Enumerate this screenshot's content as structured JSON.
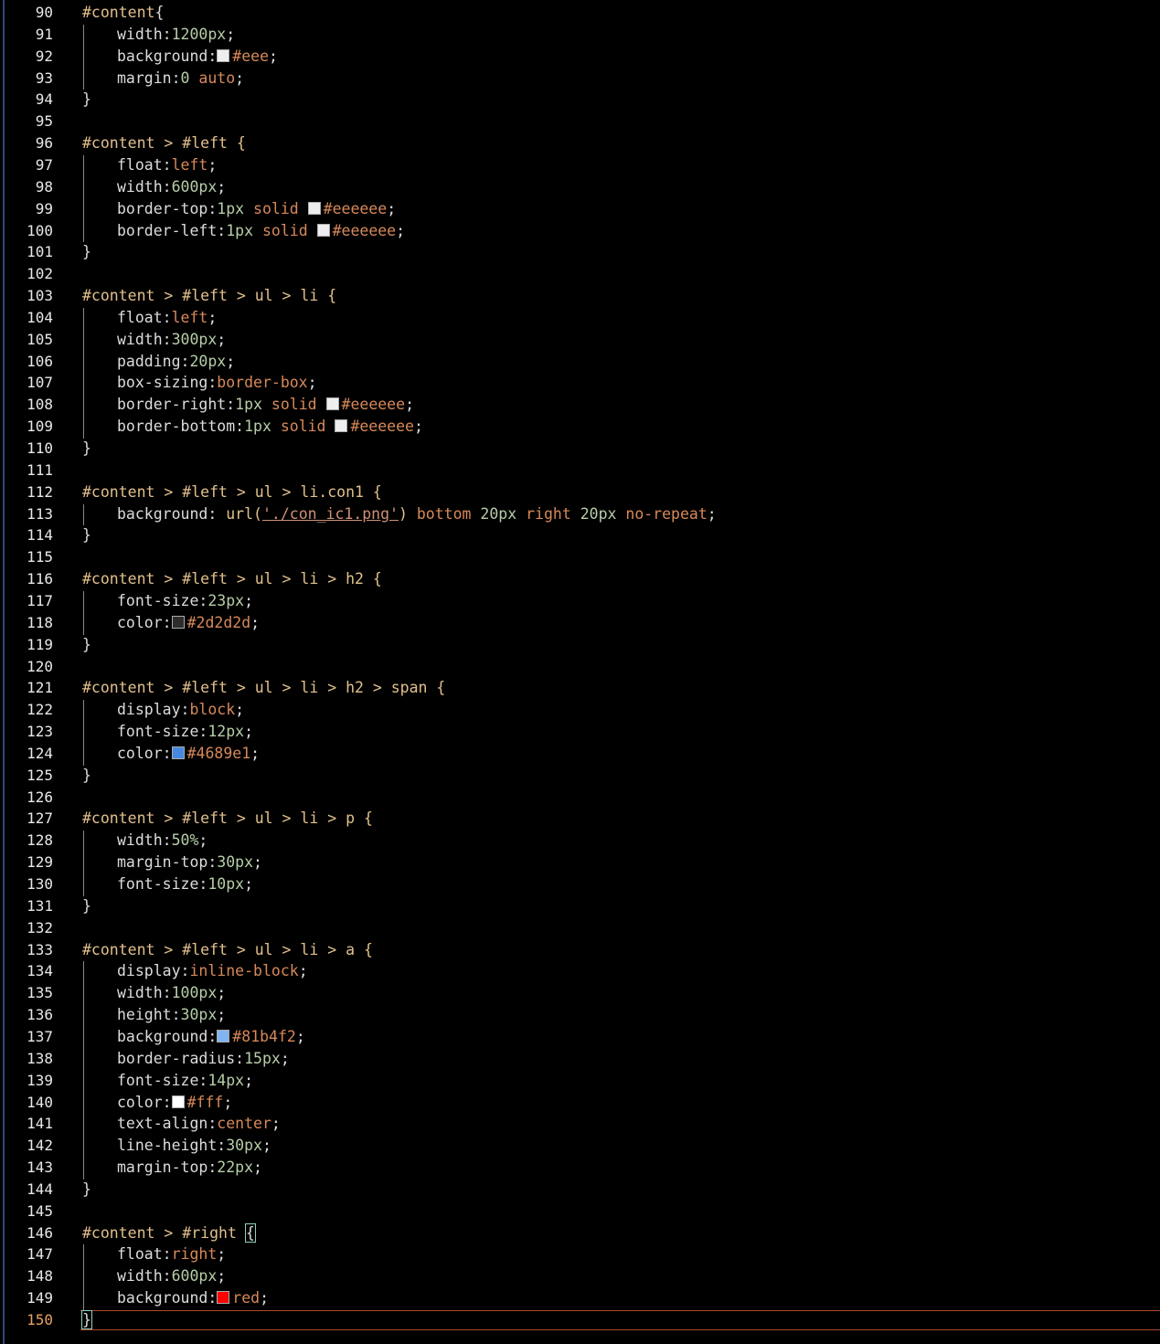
{
  "editor": {
    "active_line": 150,
    "lines": [
      {
        "n": 90,
        "indent": 0,
        "tokens": [
          {
            "t": "#content",
            "c": "sel"
          },
          {
            "t": "{",
            "c": "punc"
          }
        ]
      },
      {
        "n": 91,
        "indent": 1,
        "tokens": [
          {
            "t": "width",
            "c": "prop"
          },
          {
            "t": ":",
            "c": "punc"
          },
          {
            "t": "1200px",
            "c": "val"
          },
          {
            "t": ";",
            "c": "punc"
          }
        ]
      },
      {
        "n": 92,
        "indent": 1,
        "tokens": [
          {
            "t": "background",
            "c": "prop"
          },
          {
            "t": ":",
            "c": "punc"
          },
          {
            "sw": "#eeeeee"
          },
          {
            "t": "#eee",
            "c": "kw"
          },
          {
            "t": ";",
            "c": "punc"
          }
        ]
      },
      {
        "n": 93,
        "indent": 1,
        "tokens": [
          {
            "t": "margin",
            "c": "prop"
          },
          {
            "t": ":",
            "c": "punc"
          },
          {
            "t": "0",
            "c": "val"
          },
          {
            "t": " auto",
            "c": "kw"
          },
          {
            "t": ";",
            "c": "punc"
          }
        ]
      },
      {
        "n": 94,
        "indent": 0,
        "tokens": [
          {
            "t": "}",
            "c": "punc"
          }
        ]
      },
      {
        "n": 95,
        "indent": 0,
        "tokens": []
      },
      {
        "n": 96,
        "indent": 0,
        "tokens": [
          {
            "t": "#content > #left {",
            "c": "sel"
          }
        ]
      },
      {
        "n": 97,
        "indent": 1,
        "tokens": [
          {
            "t": "float",
            "c": "prop"
          },
          {
            "t": ":",
            "c": "punc"
          },
          {
            "t": "left",
            "c": "kw"
          },
          {
            "t": ";",
            "c": "punc"
          }
        ]
      },
      {
        "n": 98,
        "indent": 1,
        "tokens": [
          {
            "t": "width",
            "c": "prop"
          },
          {
            "t": ":",
            "c": "punc"
          },
          {
            "t": "600px",
            "c": "val"
          },
          {
            "t": ";",
            "c": "punc"
          }
        ]
      },
      {
        "n": 99,
        "indent": 1,
        "tokens": [
          {
            "t": "border-top",
            "c": "prop"
          },
          {
            "t": ":",
            "c": "punc"
          },
          {
            "t": "1px",
            "c": "val"
          },
          {
            "t": " solid ",
            "c": "kw"
          },
          {
            "sw": "#eeeeee"
          },
          {
            "t": "#eeeeee",
            "c": "kw"
          },
          {
            "t": ";",
            "c": "punc"
          }
        ]
      },
      {
        "n": 100,
        "indent": 1,
        "tokens": [
          {
            "t": "border-left",
            "c": "prop"
          },
          {
            "t": ":",
            "c": "punc"
          },
          {
            "t": "1px",
            "c": "val"
          },
          {
            "t": " solid ",
            "c": "kw"
          },
          {
            "sw": "#eeeeee"
          },
          {
            "t": "#eeeeee",
            "c": "kw"
          },
          {
            "t": ";",
            "c": "punc"
          }
        ]
      },
      {
        "n": 101,
        "indent": 0,
        "tokens": [
          {
            "t": "}",
            "c": "punc"
          }
        ]
      },
      {
        "n": 102,
        "indent": 0,
        "tokens": []
      },
      {
        "n": 103,
        "indent": 0,
        "tokens": [
          {
            "t": "#content > #left > ul > li {",
            "c": "sel"
          }
        ]
      },
      {
        "n": 104,
        "indent": 1,
        "tokens": [
          {
            "t": "float",
            "c": "prop"
          },
          {
            "t": ":",
            "c": "punc"
          },
          {
            "t": "left",
            "c": "kw"
          },
          {
            "t": ";",
            "c": "punc"
          }
        ]
      },
      {
        "n": 105,
        "indent": 1,
        "tokens": [
          {
            "t": "width",
            "c": "prop"
          },
          {
            "t": ":",
            "c": "punc"
          },
          {
            "t": "300px",
            "c": "val"
          },
          {
            "t": ";",
            "c": "punc"
          }
        ]
      },
      {
        "n": 106,
        "indent": 1,
        "tokens": [
          {
            "t": "padding",
            "c": "prop"
          },
          {
            "t": ":",
            "c": "punc"
          },
          {
            "t": "20px",
            "c": "val"
          },
          {
            "t": ";",
            "c": "punc"
          }
        ]
      },
      {
        "n": 107,
        "indent": 1,
        "tokens": [
          {
            "t": "box-sizing",
            "c": "prop"
          },
          {
            "t": ":",
            "c": "punc"
          },
          {
            "t": "border-box",
            "c": "kw"
          },
          {
            "t": ";",
            "c": "punc"
          }
        ]
      },
      {
        "n": 108,
        "indent": 1,
        "tokens": [
          {
            "t": "border-right",
            "c": "prop"
          },
          {
            "t": ":",
            "c": "punc"
          },
          {
            "t": "1px",
            "c": "val"
          },
          {
            "t": " solid ",
            "c": "kw"
          },
          {
            "sw": "#eeeeee"
          },
          {
            "t": "#eeeeee",
            "c": "kw"
          },
          {
            "t": ";",
            "c": "punc"
          }
        ]
      },
      {
        "n": 109,
        "indent": 1,
        "tokens": [
          {
            "t": "border-bottom",
            "c": "prop"
          },
          {
            "t": ":",
            "c": "punc"
          },
          {
            "t": "1px",
            "c": "val"
          },
          {
            "t": " solid ",
            "c": "kw"
          },
          {
            "sw": "#eeeeee"
          },
          {
            "t": "#eeeeee",
            "c": "kw"
          },
          {
            "t": ";",
            "c": "punc"
          }
        ]
      },
      {
        "n": 110,
        "indent": 0,
        "tokens": [
          {
            "t": "}",
            "c": "punc"
          }
        ]
      },
      {
        "n": 111,
        "indent": 0,
        "tokens": []
      },
      {
        "n": 112,
        "indent": 0,
        "tokens": [
          {
            "t": "#content > #left > ul > li.con1 {",
            "c": "sel"
          }
        ]
      },
      {
        "n": 113,
        "indent": 1,
        "tokens": [
          {
            "t": "background",
            "c": "prop"
          },
          {
            "t": ": ",
            "c": "punc"
          },
          {
            "t": "url(",
            "c": "sel"
          },
          {
            "t": "'./con_ic1.png'",
            "c": "str"
          },
          {
            "t": ")",
            "c": "sel"
          },
          {
            "t": " bottom ",
            "c": "kw"
          },
          {
            "t": "20px",
            "c": "val"
          },
          {
            "t": " right ",
            "c": "kw"
          },
          {
            "t": "20px",
            "c": "val"
          },
          {
            "t": " no-repeat",
            "c": "kw"
          },
          {
            "t": ";",
            "c": "punc"
          }
        ]
      },
      {
        "n": 114,
        "indent": 0,
        "tokens": [
          {
            "t": "}",
            "c": "punc"
          }
        ]
      },
      {
        "n": 115,
        "indent": 0,
        "tokens": []
      },
      {
        "n": 116,
        "indent": 0,
        "tokens": [
          {
            "t": "#content > #left > ul > li > h2 {",
            "c": "sel"
          }
        ]
      },
      {
        "n": 117,
        "indent": 1,
        "tokens": [
          {
            "t": "font-size",
            "c": "prop"
          },
          {
            "t": ":",
            "c": "punc"
          },
          {
            "t": "23px",
            "c": "val"
          },
          {
            "t": ";",
            "c": "punc"
          }
        ]
      },
      {
        "n": 118,
        "indent": 1,
        "tokens": [
          {
            "t": "color",
            "c": "prop"
          },
          {
            "t": ":",
            "c": "punc"
          },
          {
            "sw": "#2d2d2d"
          },
          {
            "t": "#2d2d2d",
            "c": "kw"
          },
          {
            "t": ";",
            "c": "punc"
          }
        ]
      },
      {
        "n": 119,
        "indent": 0,
        "tokens": [
          {
            "t": "}",
            "c": "punc"
          }
        ]
      },
      {
        "n": 120,
        "indent": 0,
        "tokens": []
      },
      {
        "n": 121,
        "indent": 0,
        "tokens": [
          {
            "t": "#content > #left > ul > li > h2 > span {",
            "c": "sel"
          }
        ]
      },
      {
        "n": 122,
        "indent": 1,
        "tokens": [
          {
            "t": "display",
            "c": "prop"
          },
          {
            "t": ":",
            "c": "punc"
          },
          {
            "t": "block",
            "c": "kw"
          },
          {
            "t": ";",
            "c": "punc"
          }
        ]
      },
      {
        "n": 123,
        "indent": 1,
        "tokens": [
          {
            "t": "font-size",
            "c": "prop"
          },
          {
            "t": ":",
            "c": "punc"
          },
          {
            "t": "12px",
            "c": "val"
          },
          {
            "t": ";",
            "c": "punc"
          }
        ]
      },
      {
        "n": 124,
        "indent": 1,
        "tokens": [
          {
            "t": "color",
            "c": "prop"
          },
          {
            "t": ":",
            "c": "punc"
          },
          {
            "sw": "#4689e1"
          },
          {
            "t": "#4689e1",
            "c": "kw"
          },
          {
            "t": ";",
            "c": "punc"
          }
        ]
      },
      {
        "n": 125,
        "indent": 0,
        "tokens": [
          {
            "t": "}",
            "c": "punc"
          }
        ]
      },
      {
        "n": 126,
        "indent": 0,
        "tokens": []
      },
      {
        "n": 127,
        "indent": 0,
        "tokens": [
          {
            "t": "#content > #left > ul > li > p {",
            "c": "sel"
          }
        ]
      },
      {
        "n": 128,
        "indent": 1,
        "tokens": [
          {
            "t": "width",
            "c": "prop"
          },
          {
            "t": ":",
            "c": "punc"
          },
          {
            "t": "50%",
            "c": "val"
          },
          {
            "t": ";",
            "c": "punc"
          }
        ]
      },
      {
        "n": 129,
        "indent": 1,
        "tokens": [
          {
            "t": "margin-top",
            "c": "prop"
          },
          {
            "t": ":",
            "c": "punc"
          },
          {
            "t": "30px",
            "c": "val"
          },
          {
            "t": ";",
            "c": "punc"
          }
        ]
      },
      {
        "n": 130,
        "indent": 1,
        "tokens": [
          {
            "t": "font-size",
            "c": "prop"
          },
          {
            "t": ":",
            "c": "punc"
          },
          {
            "t": "10px",
            "c": "val"
          },
          {
            "t": ";",
            "c": "punc"
          }
        ]
      },
      {
        "n": 131,
        "indent": 0,
        "tokens": [
          {
            "t": "}",
            "c": "punc"
          }
        ]
      },
      {
        "n": 132,
        "indent": 0,
        "tokens": []
      },
      {
        "n": 133,
        "indent": 0,
        "tokens": [
          {
            "t": "#content > #left > ul > li > a {",
            "c": "sel"
          }
        ]
      },
      {
        "n": 134,
        "indent": 1,
        "tokens": [
          {
            "t": "display",
            "c": "prop"
          },
          {
            "t": ":",
            "c": "punc"
          },
          {
            "t": "inline-block",
            "c": "kw"
          },
          {
            "t": ";",
            "c": "punc"
          }
        ]
      },
      {
        "n": 135,
        "indent": 1,
        "tokens": [
          {
            "t": "width",
            "c": "prop"
          },
          {
            "t": ":",
            "c": "punc"
          },
          {
            "t": "100px",
            "c": "val"
          },
          {
            "t": ";",
            "c": "punc"
          }
        ]
      },
      {
        "n": 136,
        "indent": 1,
        "tokens": [
          {
            "t": "height",
            "c": "prop"
          },
          {
            "t": ":",
            "c": "punc"
          },
          {
            "t": "30px",
            "c": "val"
          },
          {
            "t": ";",
            "c": "punc"
          }
        ]
      },
      {
        "n": 137,
        "indent": 1,
        "tokens": [
          {
            "t": "background",
            "c": "prop"
          },
          {
            "t": ":",
            "c": "punc"
          },
          {
            "sw": "#81b4f2"
          },
          {
            "t": "#81b4f2",
            "c": "kw"
          },
          {
            "t": ";",
            "c": "punc"
          }
        ]
      },
      {
        "n": 138,
        "indent": 1,
        "tokens": [
          {
            "t": "border-radius",
            "c": "prop"
          },
          {
            "t": ":",
            "c": "punc"
          },
          {
            "t": "15px",
            "c": "val"
          },
          {
            "t": ";",
            "c": "punc"
          }
        ]
      },
      {
        "n": 139,
        "indent": 1,
        "tokens": [
          {
            "t": "font-size",
            "c": "prop"
          },
          {
            "t": ":",
            "c": "punc"
          },
          {
            "t": "14px",
            "c": "val"
          },
          {
            "t": ";",
            "c": "punc"
          }
        ]
      },
      {
        "n": 140,
        "indent": 1,
        "tokens": [
          {
            "t": "color",
            "c": "prop"
          },
          {
            "t": ":",
            "c": "punc"
          },
          {
            "sw": "#ffffff"
          },
          {
            "t": "#fff",
            "c": "kw"
          },
          {
            "t": ";",
            "c": "punc"
          }
        ]
      },
      {
        "n": 141,
        "indent": 1,
        "tokens": [
          {
            "t": "text-align",
            "c": "prop"
          },
          {
            "t": ":",
            "c": "punc"
          },
          {
            "t": "center",
            "c": "kw"
          },
          {
            "t": ";",
            "c": "punc"
          }
        ]
      },
      {
        "n": 142,
        "indent": 1,
        "tokens": [
          {
            "t": "line-height",
            "c": "prop"
          },
          {
            "t": ":",
            "c": "punc"
          },
          {
            "t": "30px",
            "c": "val"
          },
          {
            "t": ";",
            "c": "punc"
          }
        ]
      },
      {
        "n": 143,
        "indent": 1,
        "tokens": [
          {
            "t": "margin-top",
            "c": "prop"
          },
          {
            "t": ":",
            "c": "punc"
          },
          {
            "t": "22px",
            "c": "val"
          },
          {
            "t": ";",
            "c": "punc"
          }
        ]
      },
      {
        "n": 144,
        "indent": 0,
        "tokens": [
          {
            "t": "}",
            "c": "punc"
          }
        ]
      },
      {
        "n": 145,
        "indent": 0,
        "tokens": []
      },
      {
        "n": 146,
        "indent": 0,
        "tokens": [
          {
            "t": "#content > #right ",
            "c": "sel"
          },
          {
            "t": "{",
            "c": "punc",
            "box": true
          }
        ]
      },
      {
        "n": 147,
        "indent": 1,
        "tokens": [
          {
            "t": "float",
            "c": "prop"
          },
          {
            "t": ":",
            "c": "punc"
          },
          {
            "t": "right",
            "c": "kw"
          },
          {
            "t": ";",
            "c": "punc"
          }
        ]
      },
      {
        "n": 148,
        "indent": 1,
        "tokens": [
          {
            "t": "width",
            "c": "prop"
          },
          {
            "t": ":",
            "c": "punc"
          },
          {
            "t": "600px",
            "c": "val"
          },
          {
            "t": ";",
            "c": "punc"
          }
        ]
      },
      {
        "n": 149,
        "indent": 1,
        "tokens": [
          {
            "t": "background",
            "c": "prop"
          },
          {
            "t": ":",
            "c": "punc"
          },
          {
            "sw": "#ff0000"
          },
          {
            "t": "red",
            "c": "kw"
          },
          {
            "t": ";",
            "c": "punc"
          }
        ]
      },
      {
        "n": 150,
        "indent": 0,
        "tokens": [
          {
            "t": "}",
            "c": "punc",
            "box": true
          }
        ]
      }
    ]
  },
  "colors": {
    "background": "#000000",
    "active_line_border": "#b0452a",
    "active_line_number": "#e8a060",
    "selector": "#e2c08d",
    "value_number": "#b5cea8",
    "value_keyword": "#d7895a"
  }
}
